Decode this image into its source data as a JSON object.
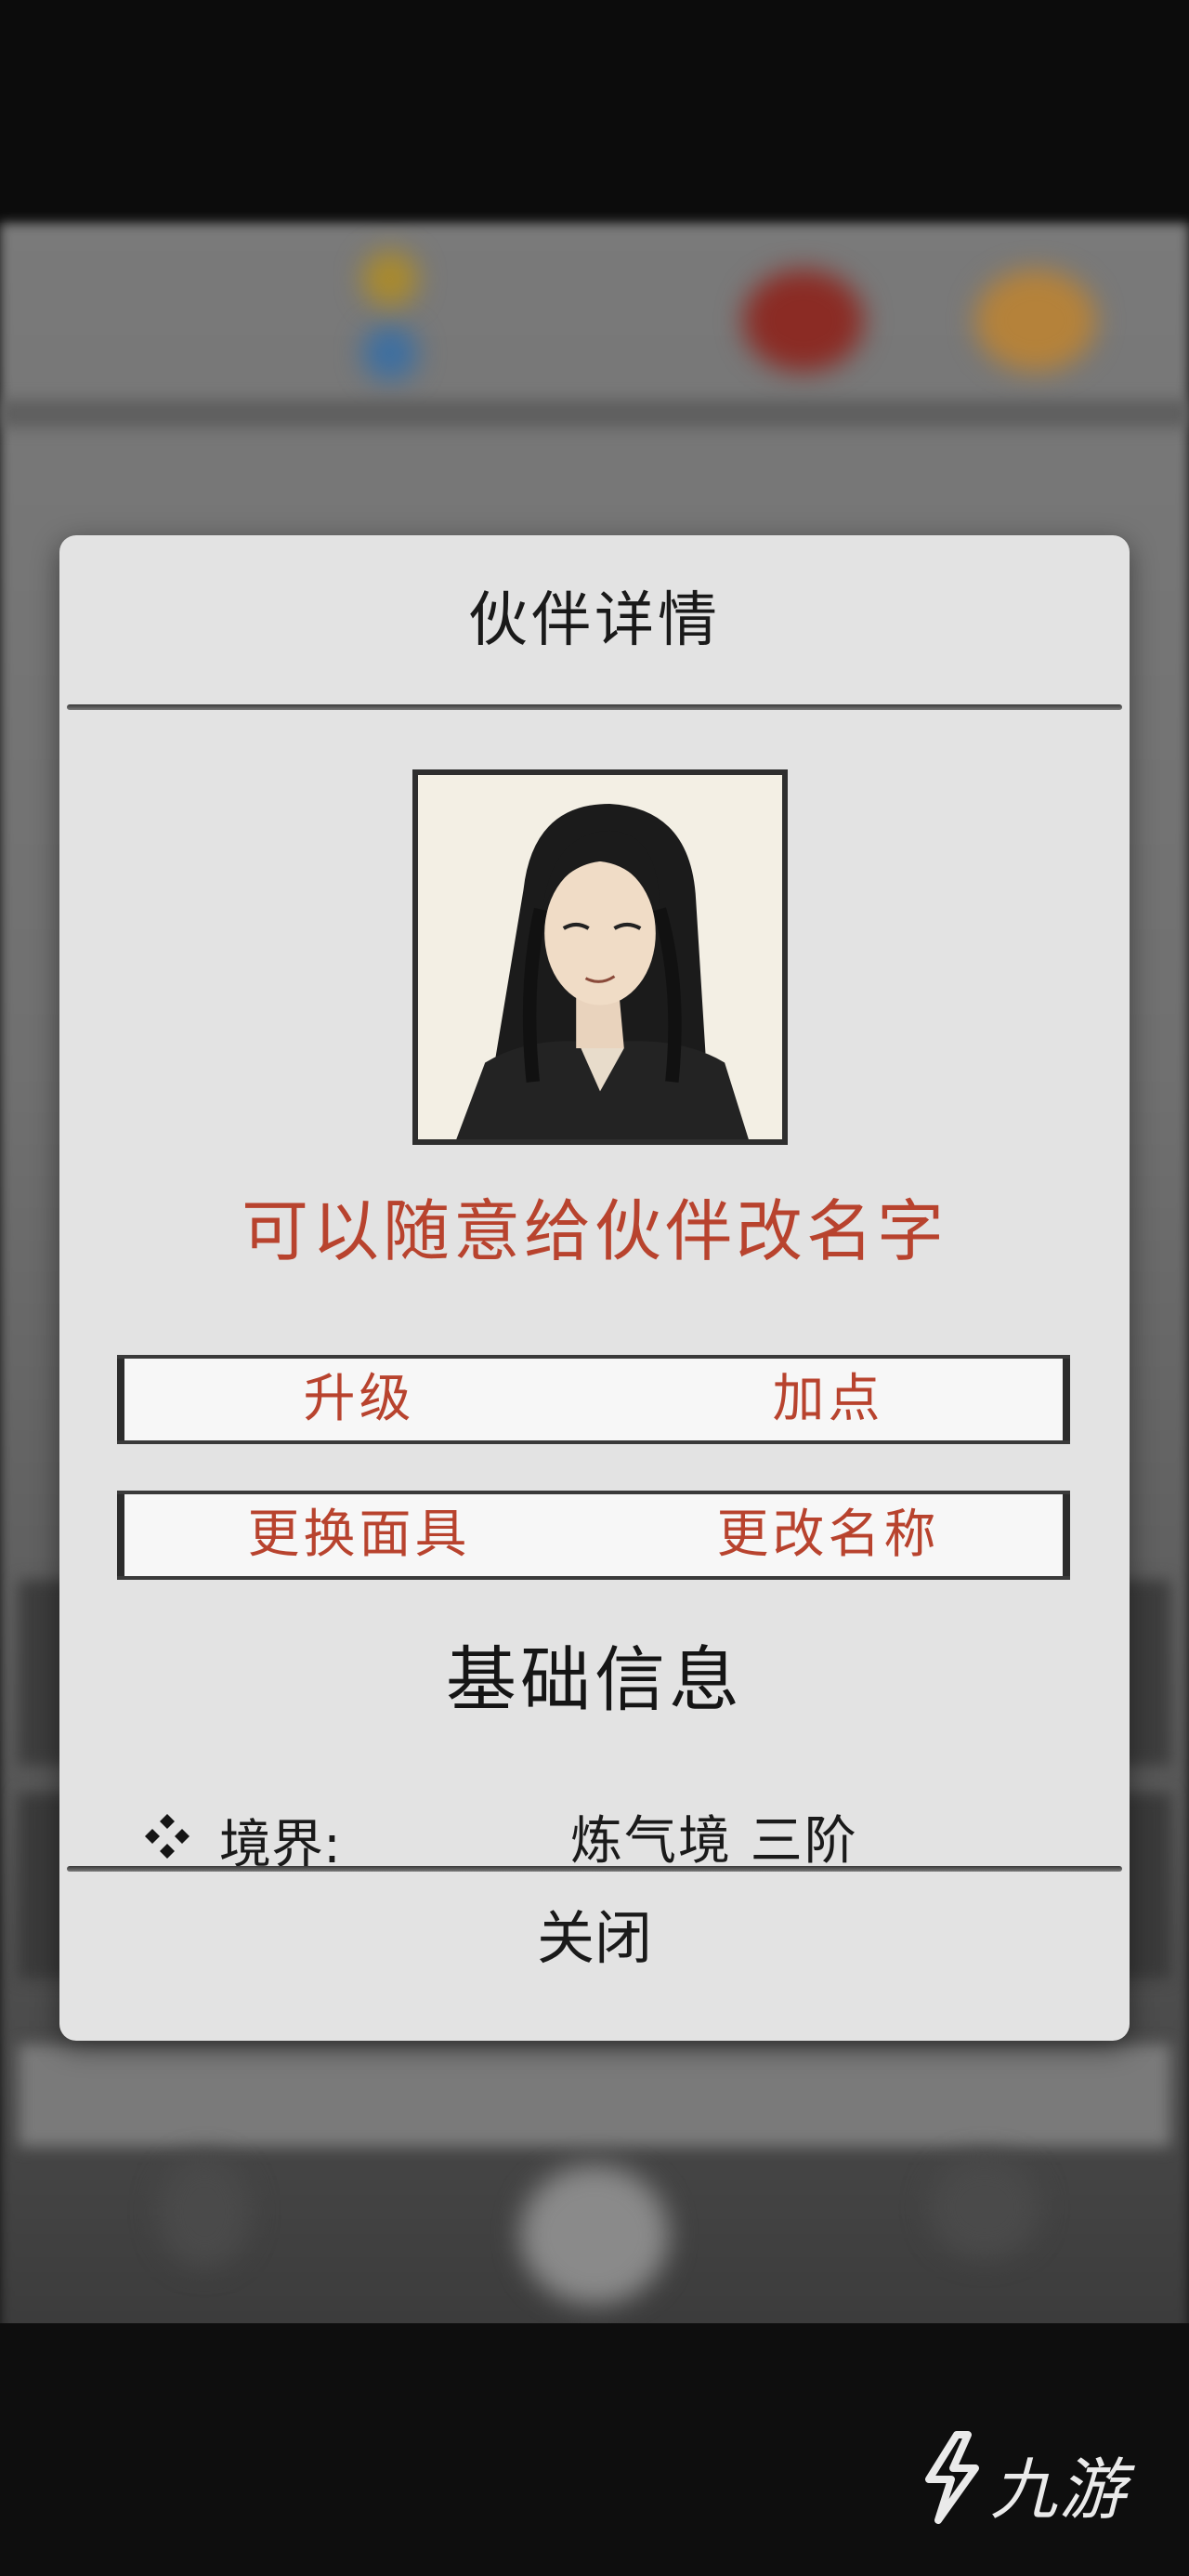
{
  "dialog": {
    "title": "伙伴详情",
    "tip": "可以随意给伙伴改名字",
    "buttons": {
      "upgrade": "升级",
      "add_points": "加点",
      "change_mask": "更换面具",
      "rename": "更改名称"
    },
    "section_title": "基础信息",
    "info": {
      "realm_label": "境界:",
      "realm_value": "炼气境 三阶"
    },
    "close": "关闭"
  },
  "watermark": {
    "text": "九游"
  },
  "colors": {
    "accent_red": "#b8432e",
    "dialog_bg": "#e3e3e3",
    "button_bg": "#f7f7f7"
  }
}
